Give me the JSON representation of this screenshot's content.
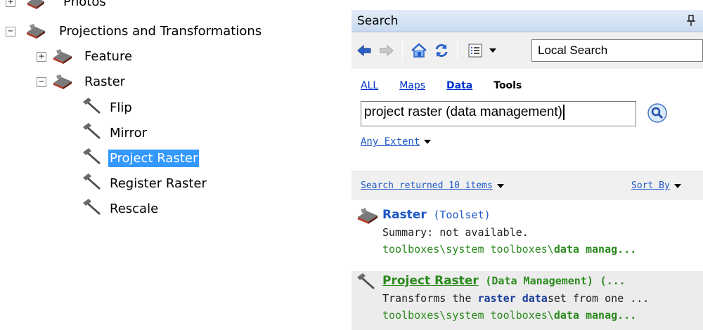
{
  "tree": {
    "items": [
      {
        "label": "Photos",
        "expander": "+",
        "icon": "toolbox-icon"
      },
      {
        "label": "Projections and Transformations",
        "expander": "−",
        "icon": "toolbox-icon"
      },
      {
        "label": "Feature",
        "expander": "+",
        "icon": "toolbox-icon"
      },
      {
        "label": "Raster",
        "expander": "−",
        "icon": "toolbox-icon"
      },
      {
        "label": "Flip",
        "icon": "hammer-icon"
      },
      {
        "label": "Mirror",
        "icon": "hammer-icon"
      },
      {
        "label": "Project Raster",
        "icon": "hammer-icon",
        "selected": true
      },
      {
        "label": "Register Raster",
        "icon": "hammer-icon"
      },
      {
        "label": "Rescale",
        "icon": "hammer-icon"
      }
    ]
  },
  "search": {
    "title": "Search",
    "scope_value": "Local Search",
    "filters": [
      {
        "label": "ALL"
      },
      {
        "label": "Maps"
      },
      {
        "label": "Data"
      },
      {
        "label": "Tools",
        "active": true
      }
    ],
    "query": "project raster (data management)",
    "extent_label": "Any Extent",
    "results_summary": "Search returned 10 items",
    "sort_label": "Sort By",
    "results": [
      {
        "title": "Raster",
        "kind": "(Toolset)",
        "summary": "Summary: not available.",
        "path_prefix": "toolboxes\\system toolboxes\\",
        "path_bold": "data manag..."
      },
      {
        "title": "Project Raster",
        "kind": "(Data Management)",
        "kind_tail": "(...",
        "summary_pre": "Transforms the ",
        "summary_b1": "raster",
        "summary_mid": " ",
        "summary_b2": "data",
        "summary_post": "set from one ...",
        "path_prefix": "toolboxes\\system toolboxes\\",
        "path_bold": "data manag..."
      }
    ]
  },
  "colors": {
    "selection": "#3399ff",
    "link_blue": "#1f58c7",
    "path_green": "#2b8a1e"
  }
}
